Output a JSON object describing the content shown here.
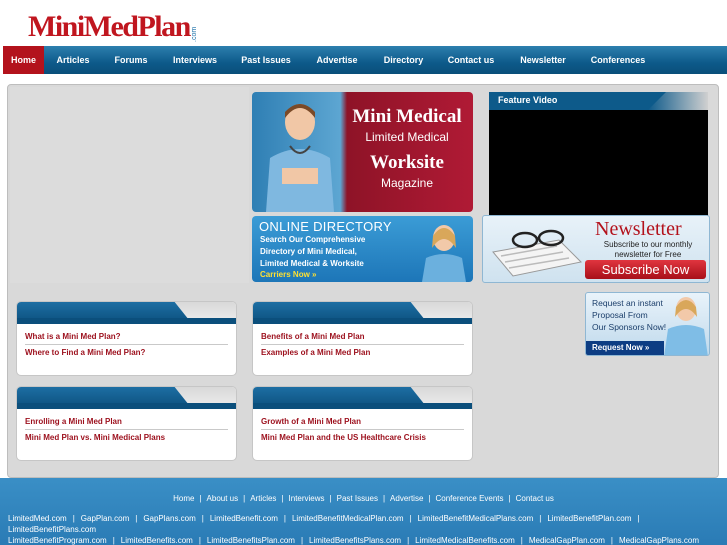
{
  "logo": {
    "main": "MiniMedPlan",
    "suffix": ".com"
  },
  "nav": [
    "Home",
    "Articles",
    "Forums",
    "Interviews",
    "Past Issues",
    "Advertise",
    "Directory",
    "Contact us",
    "Newsletter",
    "Conferences"
  ],
  "hero": {
    "line1": "Mini Medical",
    "line2": "Limited Medical",
    "line3": "Worksite",
    "line4": "Magazine"
  },
  "directory": {
    "title": "ONLINE DIRECTORY",
    "line1": "Search Our Comprehensive",
    "line2": "Directory of Mini Medical,",
    "line3": "Limited Medical & Worksite",
    "cta": "Carriers Now »"
  },
  "video": {
    "title": "Feature Video"
  },
  "boxes": [
    {
      "links": [
        "What is a Mini Med Plan?",
        "Where to Find a Mini Med Plan?"
      ]
    },
    {
      "links": [
        "Benefits of a Mini Med Plan",
        "Examples of a Mini Med Plan"
      ]
    },
    {
      "links": [
        "Enrolling a Mini Med Plan",
        "Mini Med Plan vs. Mini Medical Plans"
      ]
    },
    {
      "links": [
        "Growth of a Mini Med Plan",
        "Mini Med Plan and the US Healthcare Crisis"
      ]
    }
  ],
  "newsletter": {
    "title": "Newsletter",
    "sub1": "Subscribe to our monthly",
    "sub2": "newsletter for Free",
    "button": "Subscribe Now"
  },
  "proposal": {
    "line1": "Request an instant",
    "line2": "Proposal From",
    "line3": "Our Sponsors Now!",
    "button": "Request Now »"
  },
  "footer": {
    "nav": [
      "Home",
      "About us",
      "Articles",
      "Interviews",
      "Past Issues",
      "Advertise",
      "Conference Events",
      "Contact us"
    ],
    "row1": [
      "LimitedMed.com",
      "GapPlan.com",
      "GapPlans.com",
      "LimitedBenefit.com",
      "LimitedBenefitMedicalPlan.com",
      "LimitedBenefitMedicalPlans.com",
      "LimitedBenefitPlan.com"
    ],
    "row2": [
      "LimitedBenefitPlans.com"
    ],
    "row3": [
      "LimitedBenefitProgram.com",
      "LimitedBenefits.com",
      "LimitedBenefitsPlan.com",
      "LimitedBenefitsPlans.com",
      "LimitedMedicalBenefits.com",
      "MedicalGapPlan.com",
      "MedicalGapPlans.com"
    ]
  },
  "colors": {
    "brand_red": "#b3121c",
    "nav_blue": "#0d5a8a",
    "footer_blue": "#3a8fc6",
    "link_red": "#9c0f1c"
  }
}
